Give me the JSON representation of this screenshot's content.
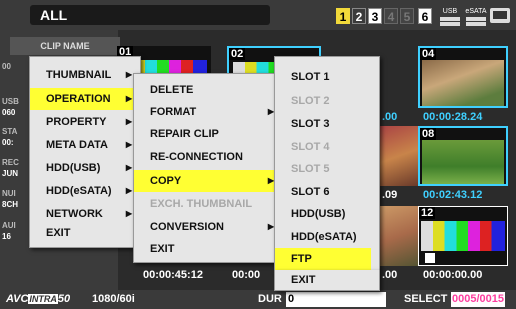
{
  "header": {
    "title": "ALL",
    "slots": [
      "1",
      "2",
      "3",
      "4",
      "5",
      "6"
    ],
    "usb_label": "USB",
    "esata_label": "eSATA"
  },
  "info_panel": {
    "clip_name_header": "CLIP NAME",
    "values": [
      "00",
      "USB",
      "060",
      "STA",
      "00:",
      "REC",
      "JUN",
      "NUI",
      "8CH",
      "AUI",
      "16"
    ]
  },
  "thumbnails": [
    {
      "number": "01",
      "timecode": ""
    },
    {
      "number": "02",
      "timecode": ""
    },
    {
      "number": "04",
      "timecode": "00:00:28.24"
    },
    {
      "number": "08",
      "timecode": "00:02:43.12"
    },
    {
      "number": "12",
      "timecode": "00:00:00.00"
    },
    {
      "number": "",
      "timecode": "00:00:45:12"
    },
    {
      "number": "",
      "timecode": "00:00"
    },
    {
      "number": "",
      "timecode": ".00"
    },
    {
      "number": "",
      "timecode": ".09"
    },
    {
      "number": "",
      "timecode": ".00"
    }
  ],
  "main_menu": {
    "items": [
      "THUMBNAIL",
      "OPERATION",
      "PROPERTY",
      "META DATA",
      "HDD(USB)",
      "HDD(eSATA)",
      "NETWORK",
      "EXIT"
    ]
  },
  "operation_menu": {
    "items": [
      "DELETE",
      "FORMAT",
      "REPAIR CLIP",
      "RE-CONNECTION",
      "COPY",
      "EXCH. THUMBNAIL",
      "CONVERSION",
      "EXIT"
    ]
  },
  "copy_menu": {
    "items": [
      "SLOT 1",
      "SLOT 2",
      "SLOT 3",
      "SLOT 4",
      "SLOT 5",
      "SLOT 6",
      "HDD(USB)",
      "HDD(eSATA)",
      "FTP",
      "EXIT"
    ]
  },
  "footer": {
    "codec_prefix": "AVC",
    "codec_brand": "INTRA",
    "codec_suffix": "50",
    "format": "1080/60i",
    "dur_label": "DUR",
    "dur_value": "0",
    "select_label": "SELECT",
    "select_value": "0005/0015"
  },
  "colors": {
    "highlight": "#ffff33",
    "selection_border": "#3fd0ff",
    "select_value": "#ff3fa0"
  }
}
